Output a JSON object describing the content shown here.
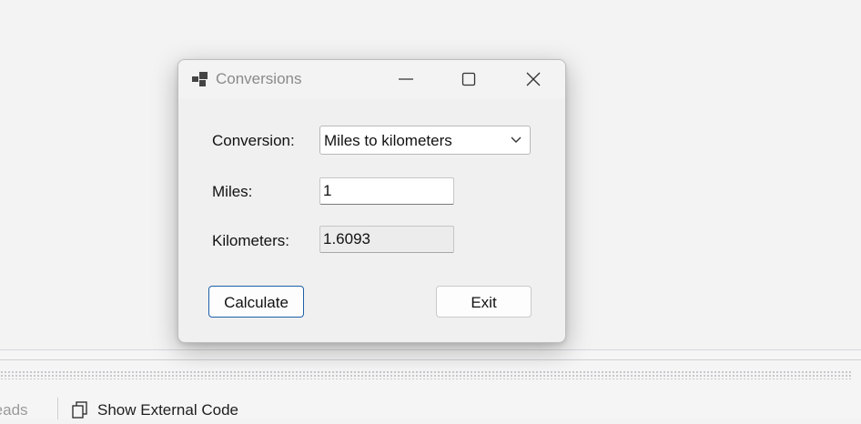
{
  "window": {
    "title": "Conversions"
  },
  "form": {
    "conversion_label": "Conversion:",
    "conversion_selected": "Miles to kilometers",
    "miles_label": "Miles:",
    "miles_value": "1",
    "kilometers_label": "Kilometers:",
    "kilometers_value": "1.6093",
    "calculate_label": "Calculate",
    "exit_label": "Exit"
  },
  "bottom_panel": {
    "threads_label": "reads",
    "show_external_code_label": "Show External Code"
  },
  "icons": {
    "app": "app-window-icon",
    "minimize": "minimize-icon",
    "maximize": "maximize-icon",
    "close": "close-icon",
    "dropdown": "chevron-down-icon",
    "external_code": "external-code-icon"
  },
  "colors": {
    "default_button_border": "#1b5fa8",
    "readonly_background": "#ececec"
  }
}
